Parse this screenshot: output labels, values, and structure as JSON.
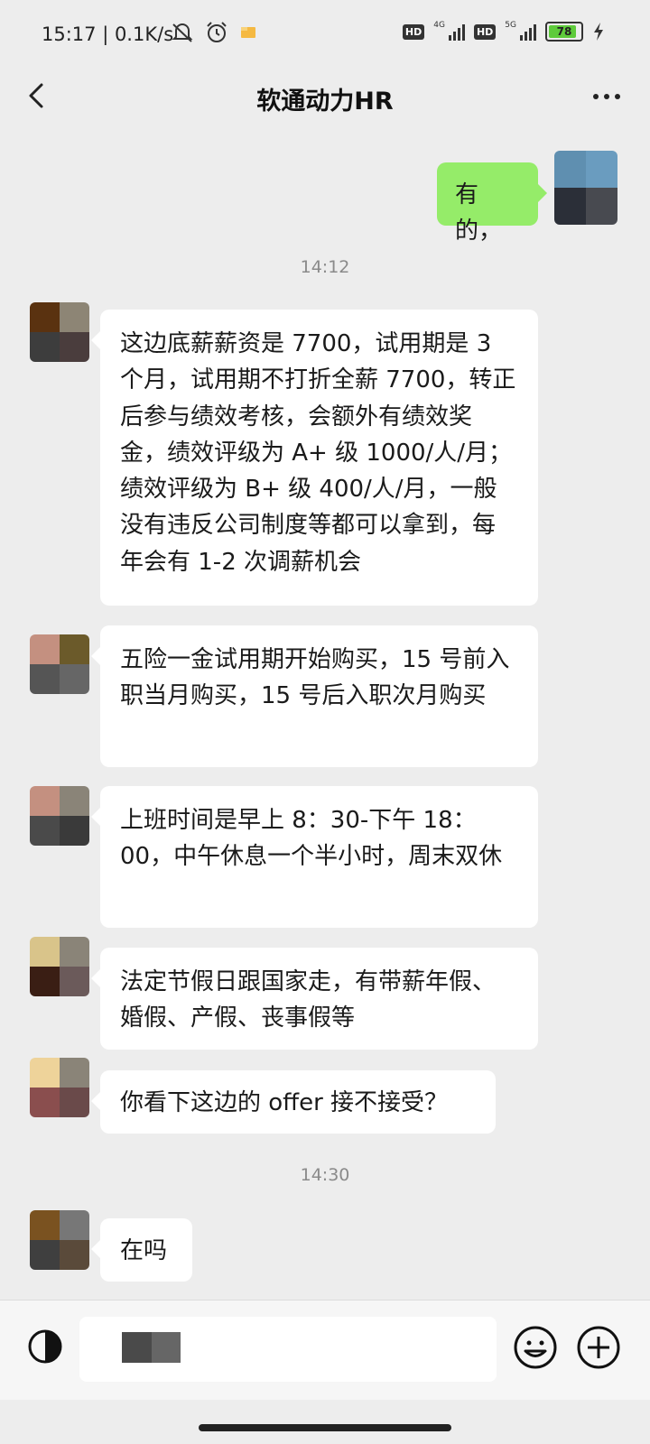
{
  "status_bar": {
    "time": "15:17 | 0.1K/s",
    "hd1": "HD",
    "net1": "4G",
    "hd2": "HD",
    "net2": "5G",
    "battery": "78"
  },
  "nav": {
    "title": "软通动力HR",
    "back_icon": "chevron-left-icon",
    "more_icon": "more-dots-icon"
  },
  "messages": [
    {
      "side": "out",
      "text": "有的，"
    },
    {
      "type": "time",
      "text": "14:12"
    },
    {
      "side": "in",
      "text": "这边底薪薪资是 7700，试用期是 3 个月，试用期不打折全薪 7700，转正后参与绩效考核，会额外有绩效奖金，绩效评级为 A+ 级 1000/人/月；绩效评级为 B+ 级 400/人/月，一般没有违反公司制度等都可以拿到，每年会有 1-2 次调薪机会"
    },
    {
      "side": "in",
      "text": "五险一金试用期开始购买，15 号前入职当月购买，15 号后入职次月购买"
    },
    {
      "side": "in",
      "text": "上班时间是早上 8：30-下午 18：00，中午休息一个半小时，周末双休"
    },
    {
      "side": "in",
      "text": "法定节假日跟国家走，有带薪年假、婚假、产假、丧事假等"
    },
    {
      "side": "in",
      "text": "你看下这边的 offer 接不接受？"
    },
    {
      "type": "time",
      "text": "14:30"
    },
    {
      "side": "in",
      "text": "在吗"
    }
  ],
  "colors": {
    "background": "#ededed",
    "incoming_bubble": "#ffffff",
    "outgoing_bubble": "#95ec69"
  },
  "input_bar": {
    "voice_icon": "voice-icon",
    "emoji_icon": "emoji-icon",
    "plus_icon": "plus-icon",
    "value": ""
  }
}
